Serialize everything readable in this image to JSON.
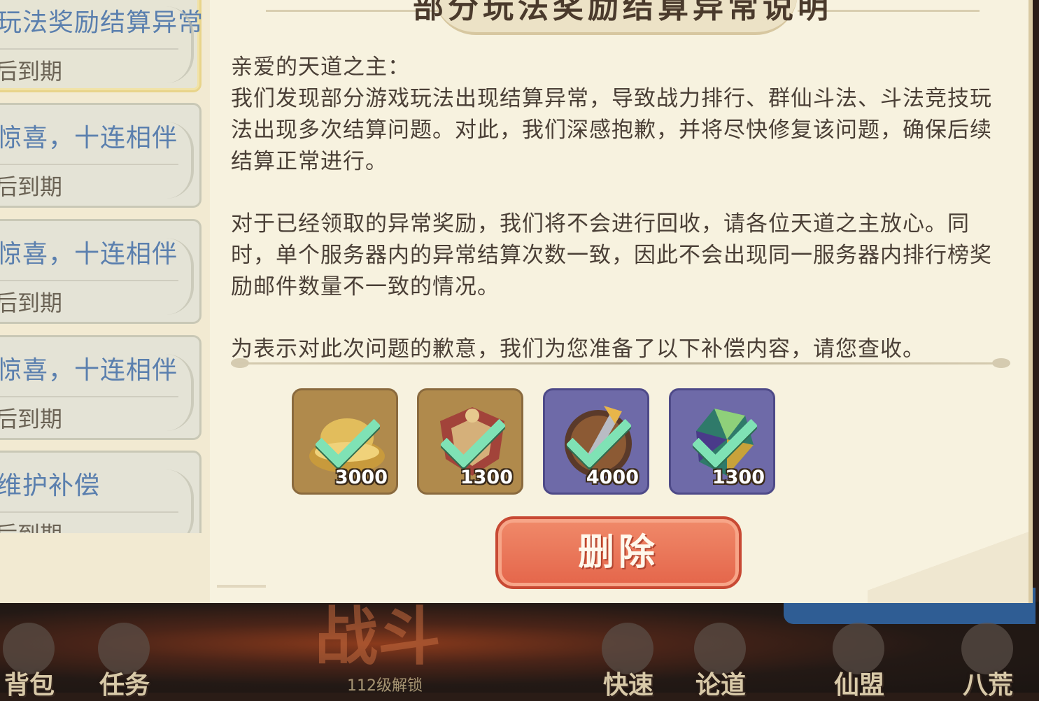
{
  "mail_list": {
    "items": [
      {
        "title": "玩法奖励结算异常",
        "expire": "后到期",
        "selected": true
      },
      {
        "title": "惊喜，十连相伴",
        "expire": "后到期",
        "selected": false
      },
      {
        "title": "惊喜，十连相伴",
        "expire": "后到期",
        "selected": false
      },
      {
        "title": "惊喜，十连相伴",
        "expire": "后到期",
        "selected": false
      },
      {
        "title": "维护补偿",
        "expire": "后到期",
        "selected": false
      }
    ]
  },
  "mail_detail": {
    "title": "部分玩法奖励结算异常说明",
    "greeting": "亲爱的天道之主：",
    "paragraph1": "我们发现部分游戏玩法出现结算异常，导致战力排行、群仙斗法、斗法竞技玩法出现多次结算问题。对此，我们深感抱歉，并将尽快修复该问题，确保后续结算正常进行。",
    "paragraph2": "对于已经领取的异常奖励，我们将不会进行回收，请各位天道之主放心。同时，单个服务器内的异常结算次数一致，因此不会出现同一服务器内排行榜奖励邮件数量不一致的情况。",
    "paragraph3": "为表示对此次问题的歉意，我们为您准备了以下补偿内容，请您查收。",
    "rewards": [
      {
        "icon": "gold-ingot-icon",
        "count": "3000",
        "claimed": true,
        "frame": "gold"
      },
      {
        "icon": "shield-badge-icon",
        "count": "1300",
        "claimed": true,
        "frame": "gold"
      },
      {
        "icon": "sword-medal-icon",
        "count": "4000",
        "claimed": true,
        "frame": "purple"
      },
      {
        "icon": "crystal-gem-icon",
        "count": "1300",
        "claimed": true,
        "frame": "purple"
      }
    ],
    "delete_label": "删除"
  },
  "bottom_nav": {
    "items": [
      {
        "label": "背包",
        "icon": "bag-icon"
      },
      {
        "label": "任务",
        "icon": "scroll-icon"
      },
      {
        "label": "快速",
        "icon": "crossed-swords-icon"
      },
      {
        "label": "论道",
        "icon": "flag-icon"
      },
      {
        "label": "仙盟",
        "icon": "banner-icon"
      },
      {
        "label": "八荒",
        "icon": "pagoda-icon"
      }
    ],
    "battle_label": "战斗",
    "battle_unlock": "112级解锁"
  },
  "colors": {
    "mail_title": "#5a7fae",
    "body_text": "#4a3f36",
    "delete_button": "#e4654a",
    "check_mark": "#7fe2b5"
  }
}
